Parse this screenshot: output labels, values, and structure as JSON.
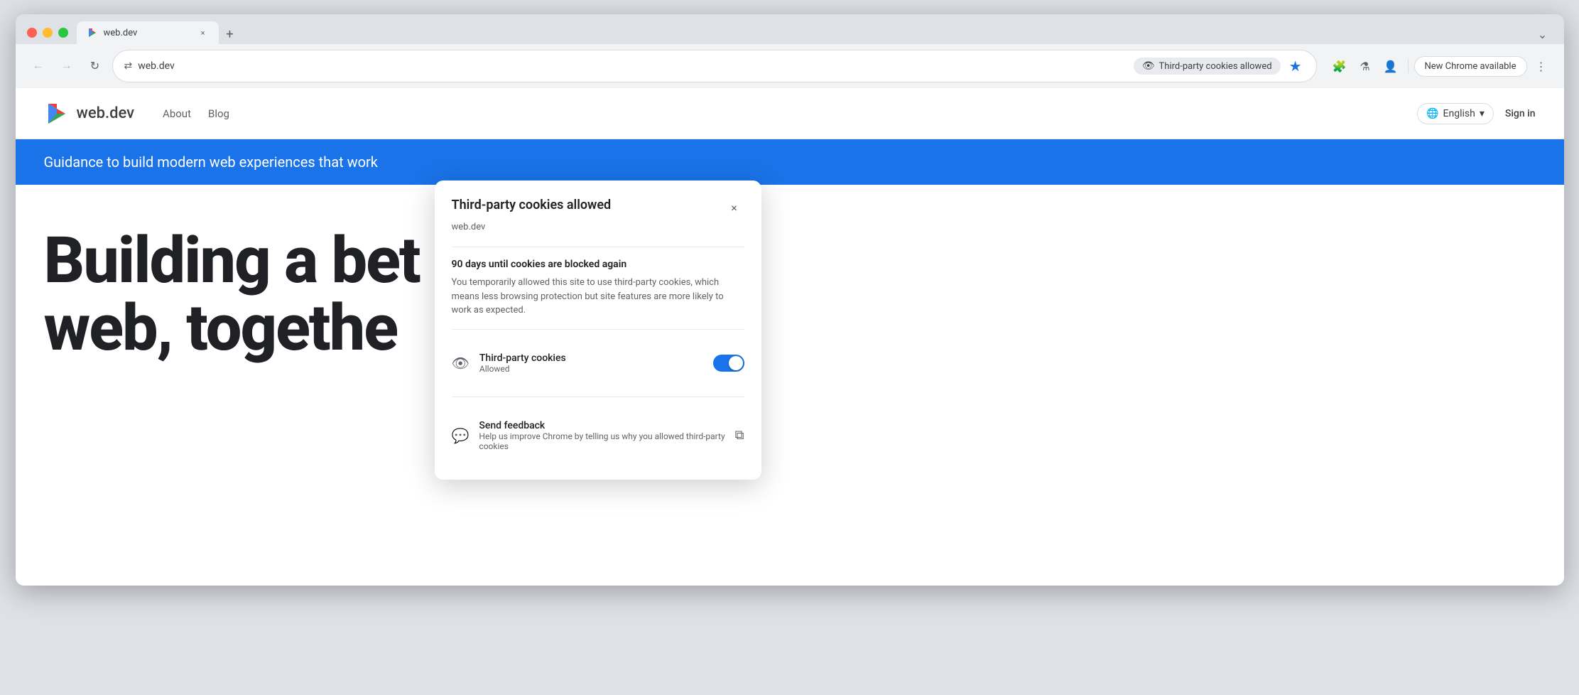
{
  "browser": {
    "tab": {
      "title": "web.dev",
      "favicon": "►"
    },
    "new_tab_icon": "+",
    "minimize_icon": "⌄"
  },
  "toolbar": {
    "back_label": "←",
    "forward_label": "→",
    "refresh_label": "↻",
    "address_icon": "⇄",
    "url": "web.dev",
    "cookie_indicator_label": "Third-party cookies allowed",
    "bookmark_icon": "★",
    "extensions_icon": "🧩",
    "flask_icon": "⚗",
    "profile_icon": "👤",
    "new_chrome_label": "New Chrome available",
    "menu_icon": "⋮"
  },
  "popup": {
    "title": "Third-party cookies allowed",
    "subtitle": "web.dev",
    "close_icon": "×",
    "warning_title": "90 days until cookies are blocked again",
    "description": "You temporarily allowed this site to use third-party cookies, which means less browsing protection but site features are more likely to work as expected.",
    "toggle_row": {
      "icon": "👁",
      "label": "Third-party cookies",
      "sublabel": "Allowed",
      "toggle_on": true
    },
    "feedback_row": {
      "icon": "💬",
      "label": "Send feedback",
      "sublabel": "Help us improve Chrome by telling us why you allowed third-party cookies",
      "external_icon": "⧉"
    }
  },
  "site": {
    "logo_icon": "►",
    "logo_text": "web.dev",
    "nav": [
      "About",
      "Blog"
    ],
    "lang_label": "English",
    "signin_label": "Sign in",
    "banner_text": "Guidance to build modern web experiences that work",
    "hero_line1": "Building a bet",
    "hero_line2": "web, togethe"
  }
}
